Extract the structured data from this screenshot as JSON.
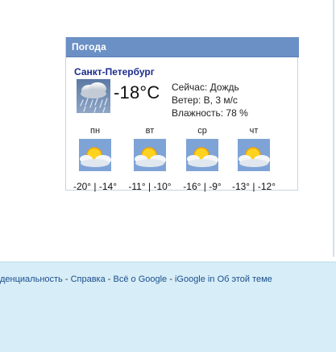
{
  "gadget": {
    "title": "Погода",
    "city": "Санкт-Петербург",
    "current": {
      "icon": "rain-cloud-icon",
      "temperature": "-18°C",
      "condition": "Сейчас: Дождь",
      "wind": "Ветер: В, 3 м/с",
      "humidity": "Влажность: 78 %"
    },
    "forecast": [
      {
        "day": "пн",
        "icon": "partly-cloudy-icon",
        "temps": "-20° | -14°"
      },
      {
        "day": "вт",
        "icon": "partly-cloudy-icon",
        "temps": "-11° | -10°"
      },
      {
        "day": "ср",
        "icon": "partly-cloudy-icon",
        "temps": "-16° | -9°"
      },
      {
        "day": "чт",
        "icon": "partly-cloudy-icon",
        "temps": "-13° | -12°"
      }
    ]
  },
  "footer": {
    "links": [
      {
        "label": "денциальность"
      },
      {
        "label": "Справка"
      },
      {
        "label": "Всё о Google"
      },
      {
        "label": "iGoogle in"
      },
      {
        "label": "Об этой теме"
      }
    ],
    "separator": " - "
  },
  "colors": {
    "header": "#6b90c5",
    "city": "#1b2b8c",
    "footer_bg": "#d7edf7",
    "link": "#1a4f8c"
  }
}
